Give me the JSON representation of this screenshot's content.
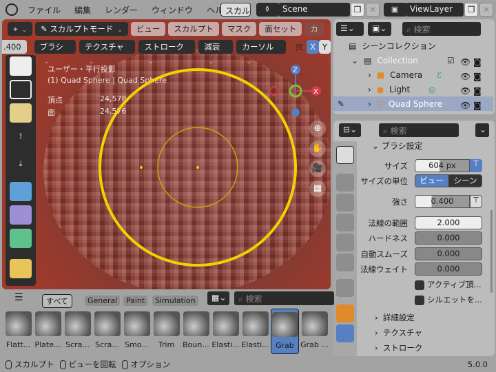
{
  "menu": [
    "ファイル",
    "編集",
    "レンダー",
    "ウィンドウ",
    "ヘルプ"
  ],
  "workspace": "スカルプト",
  "scene": "Scene",
  "view_layer": "ViewLayer",
  "viewport": {
    "header": {
      "mode": "スカルプトモード",
      "menus": [
        "ビュー",
        "スカルプト",
        "マスク",
        "面セット"
      ],
      "extra": "カ"
    },
    "tool_header": {
      "value": ".400",
      "menus": [
        "ブラシ",
        "テクスチャ",
        "ストローク",
        "減衰",
        "カーソル"
      ],
      "axes": [
        "X",
        "Y"
      ]
    },
    "overlay": {
      "view": "ユーザー・平行投影",
      "object": "(1) Quad Sphere | Quad Sphere",
      "stats": [
        {
          "label": "頂点",
          "value": "24,578"
        },
        {
          "label": "面",
          "value": "24,576"
        }
      ]
    },
    "gizmo": {
      "z": "Z",
      "y": "Y",
      "x": "X"
    },
    "colors": {
      "brush_circle": "#f5d000",
      "accent": "#5680c2"
    }
  },
  "outliner": {
    "search_placeholder": "検索",
    "scene_collection": "シーンコレクション",
    "items": [
      {
        "name": "Collection"
      },
      {
        "name": "Camera"
      },
      {
        "name": "Light"
      },
      {
        "name": "Quad Sphere",
        "selected": true
      }
    ]
  },
  "properties": {
    "search_placeholder": "検索",
    "panel": "ブラシ設定",
    "size": {
      "label": "サイズ",
      "value": "604 px"
    },
    "size_unit": {
      "label": "サイズの単位",
      "options": [
        "ビュー",
        "シーン"
      ],
      "selected": "ビュー"
    },
    "strength": {
      "label": "強さ",
      "value": "0.400",
      "fraction": 0.4
    },
    "fields": [
      {
        "label": "法線の範囲",
        "value": "2.000"
      },
      {
        "label": "ハードネス",
        "value": "0.000"
      },
      {
        "label": "自動スムーズ",
        "value": "0.000"
      },
      {
        "label": "法線ウェイト",
        "value": "0.000"
      }
    ],
    "checkboxes": [
      "アクティブ頂...",
      "シルエットを..."
    ],
    "subpanels": [
      "詳細設定",
      "テクスチャ",
      "ストローク"
    ]
  },
  "shelf": {
    "tabs": [
      "すべて",
      "General",
      "Paint",
      "Simulation"
    ],
    "search_placeholder": "検索",
    "assets": [
      "Flatt...",
      "Plate...",
      "Scra...",
      "Scra...",
      "Smo...",
      "Trim",
      "Boun...",
      "Elasti...",
      "Elasti...",
      "Grab",
      "Grab ..."
    ],
    "active": "Grab"
  },
  "status": {
    "items": [
      "スカルプト",
      "ビューを回転",
      "オプション"
    ],
    "version": "5.0.0"
  }
}
